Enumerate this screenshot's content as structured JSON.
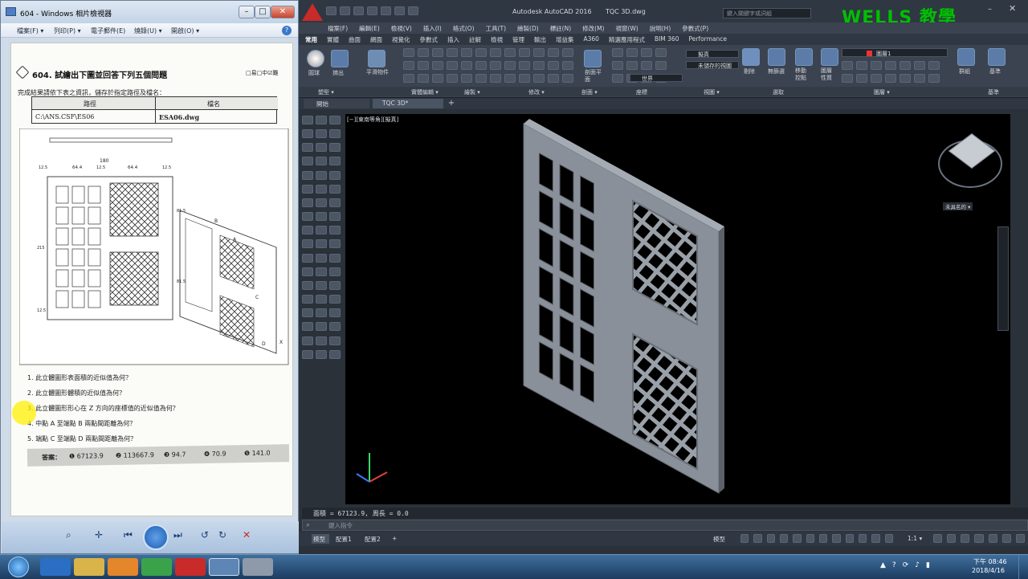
{
  "viewer": {
    "title": "604 - Windows 相片檢視器",
    "menu": [
      "檔案(F) ▾",
      "列印(P) ▾",
      "電子郵件(E)",
      "燒錄(U) ▾",
      "開啟(O) ▾"
    ],
    "question_title": "604. 試繪出下圖並回答下列五個問題",
    "difficulty": "□易□中☑難",
    "instruction": "完成結果請依下表之資訊，儲存於指定路徑及檔名：",
    "table_headers": [
      "路徑",
      "檔名"
    ],
    "table_values": [
      "C:\\ANS.CSF\\ES06",
      "ESA06.dwg"
    ],
    "questions": [
      "1. 此立體圖形表面積的近似值為何？",
      "2. 此立體圖形體積的近似值為何？",
      "3. 此立體圖形形心在 Z 方向的座標值的近似值為何？",
      "4. 中點 A 至端點 B 兩點間距離為何？",
      "5. 端點 C 至端點 D 兩點間距離為何？"
    ],
    "answer_label": "答案：",
    "answers": [
      "❶ 67123.9",
      "❷ 113667.9",
      "❸ 94.7",
      "❹ 70.9",
      "❺ 141.0"
    ],
    "drawing_dims": [
      "180",
      "64.4",
      "64.4",
      "12.5",
      "12.5",
      "12.5",
      "81.5",
      "81.5",
      "215",
      "12.5",
      "A",
      "B",
      "C",
      "D",
      "X"
    ]
  },
  "acad": {
    "title": "Autodesk AutoCAD 2016",
    "filename": "TQC 3D.dwg",
    "search_placeholder": "鍵入關鍵字或詞組",
    "logo": "WELLS 教學",
    "menu": [
      "檔案(F)",
      "編輯(E)",
      "檢視(V)",
      "插入(I)",
      "格式(O)",
      "工具(T)",
      "繪製(D)",
      "標註(N)",
      "修改(M)",
      "視窗(W)",
      "說明(H)",
      "參數式(P)"
    ],
    "ribbon_tabs": [
      "常用",
      "實體",
      "曲面",
      "網面",
      "視覺化",
      "參數式",
      "插入",
      "註解",
      "檢視",
      "管理",
      "輸出",
      "增益集",
      "A360",
      "精選應用程式",
      "BIM 360",
      "Performance"
    ],
    "ribbon_groups": [
      "塑型 ▾",
      "實體編輯 ▾",
      "繪製 ▾",
      "修改 ▾",
      "剖面 ▾",
      "座標",
      "視圖 ▾",
      "選取",
      "圖層 ▾",
      "基準"
    ],
    "ribbon_labels": {
      "box": "圓球",
      "extrude": "擠出",
      "smooth": "平滑物件",
      "section_plane": "剖面平面",
      "no_filter": "無篩選",
      "move_gizmo": "移動控點",
      "layer_props": "圖層性質",
      "group": "群組",
      "base": "基準",
      "cull": "剔除",
      "view_style": "擬真",
      "view_saved": "未儲存的視圖",
      "layer_name": "圖層1",
      "world": "世界"
    },
    "doc_tabs": [
      "開始",
      "TQC 3D*"
    ],
    "viewport_label": "[−][東南等角][擬真]",
    "viewcube_label": "未具名的 ▾",
    "command_history": "面積 = 67123.9, 周長 = 0.0",
    "command_placeholder": "鍵入指令",
    "layout_tabs": [
      "模型",
      "配置1",
      "配置2",
      "+"
    ],
    "status_model": "模型",
    "status_scale": "1:1 ▾"
  },
  "taskbar": {
    "time": "下午 08:46",
    "date": "2018/4/16"
  },
  "colors": {
    "acad_bg": "#2b3139",
    "viewport_bg": "#000000",
    "window_model": "#8a9099",
    "title_red": "#e83a2a",
    "wells": "#00c000",
    "jiao": "#1e6cff"
  }
}
